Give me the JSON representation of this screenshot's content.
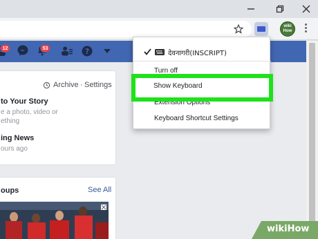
{
  "window": {
    "minimize_icon": "minimize-icon",
    "restore_icon": "restore-icon",
    "close_icon": "close-icon"
  },
  "toolbar": {
    "star_icon": "star-icon",
    "extension_icon": "keyboard-extension-icon",
    "profile_text": "wiki How",
    "menu_icon": "vertical-dots-icon"
  },
  "facebook_bar": {
    "friend_requests_badge": "12",
    "notifications_badge": "53",
    "color": "#4267b2"
  },
  "stories": {
    "archive_label": "Archive",
    "separator": "·",
    "settings_label": "Settings",
    "add_story_title": "to Your Story",
    "add_story_sub1": "e a photo, video or",
    "add_story_sub2": "ething",
    "news_title": "ing News",
    "news_time": "ours ago"
  },
  "groups": {
    "title": "oups",
    "see_all": "See All"
  },
  "menu": {
    "selected_label": "देवनागरी(INSCRIPT)",
    "items": [
      {
        "label": "Turn off"
      },
      {
        "label": "Show Keyboard"
      },
      {
        "label": "Extension Options"
      },
      {
        "label": "Keyboard Shortcut Settings"
      }
    ],
    "highlight_color": "#1ee21a"
  },
  "watermark": {
    "text": "wikiHow"
  }
}
